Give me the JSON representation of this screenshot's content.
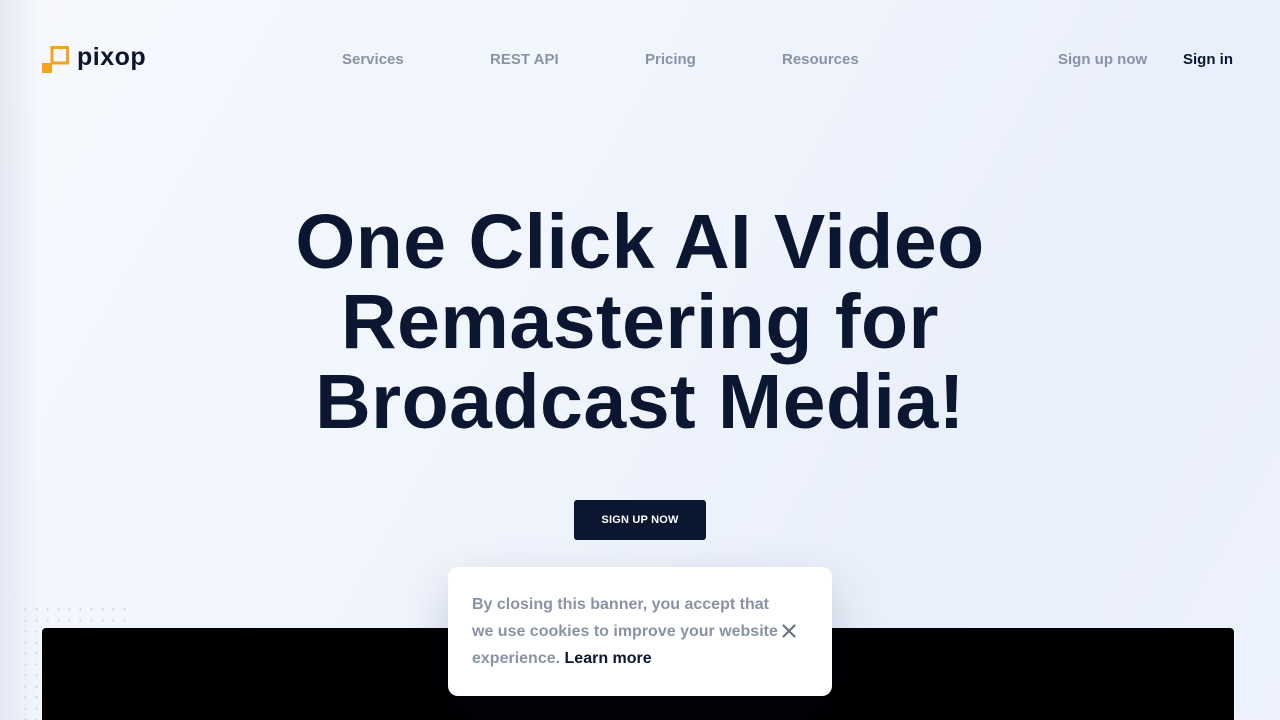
{
  "brand": {
    "name": "pixop",
    "accent_color": "#f5a31a",
    "dark_color": "#0b1730"
  },
  "nav": {
    "items": [
      {
        "label": "Services"
      },
      {
        "label": "REST API"
      },
      {
        "label": "Pricing"
      },
      {
        "label": "Resources"
      }
    ],
    "signup_label": "Sign up now",
    "signin_label": "Sign in"
  },
  "hero": {
    "title": "One Click AI Video Remastering for Broadcast Media!",
    "cta_label": "SIGN UP NOW"
  },
  "cookie_banner": {
    "text": "By closing this banner, you accept that we use cookies to improve your website experience.",
    "link_label": "Learn more",
    "close_icon": "close-icon"
  }
}
